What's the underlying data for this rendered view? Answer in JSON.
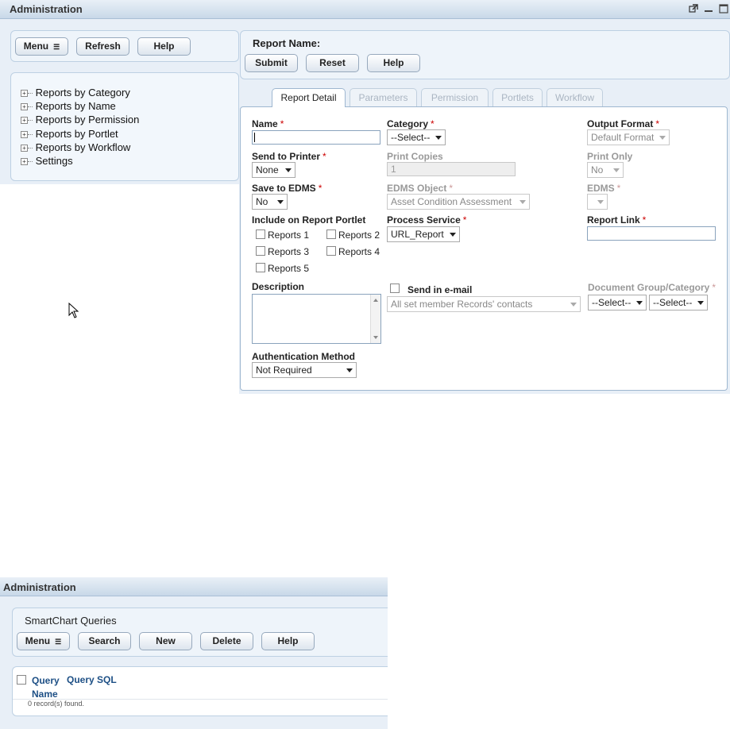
{
  "top": {
    "title": "Administration",
    "left_toolbar": {
      "menu": "Menu",
      "menu_icon": "hamburger-arrow-icon",
      "refresh": "Refresh",
      "help": "Help"
    },
    "tree": [
      {
        "label": "Reports by Category"
      },
      {
        "label": "Reports by Name"
      },
      {
        "label": "Reports by Permission"
      },
      {
        "label": "Reports by Portlet"
      },
      {
        "label": "Reports by Workflow"
      },
      {
        "label": "Settings"
      }
    ],
    "report": {
      "header_label": "Report Name:",
      "buttons": {
        "submit": "Submit",
        "reset": "Reset",
        "help": "Help"
      },
      "tabs": [
        "Report Detail",
        "Parameters",
        "Permission",
        "Portlets",
        "Workflow"
      ],
      "form": {
        "name": {
          "label": "Name",
          "value": ""
        },
        "category": {
          "label": "Category",
          "value": "--Select--"
        },
        "output_format": {
          "label": "Output Format",
          "value": "Default Format"
        },
        "send_to_printer": {
          "label": "Send to Printer",
          "value": "None"
        },
        "print_copies": {
          "label": "Print Copies",
          "value": "1"
        },
        "print_only": {
          "label": "Print Only",
          "value": "No"
        },
        "save_to_edms": {
          "label": "Save to EDMS",
          "value": "No"
        },
        "edms_object": {
          "label": "EDMS Object",
          "value": "Asset Condition Assessment"
        },
        "edms": {
          "label": "EDMS",
          "value": ""
        },
        "include_portlet": {
          "label": "Include on Report Portlet",
          "options": [
            "Reports 1",
            "Reports 2",
            "Reports 3",
            "Reports 4",
            "Reports 5"
          ]
        },
        "process_service": {
          "label": "Process Service",
          "value": "URL_Report"
        },
        "report_link": {
          "label": "Report Link",
          "value": ""
        },
        "description": {
          "label": "Description",
          "value": ""
        },
        "send_email": {
          "label": "Send in e-mail",
          "value": "All set member Records' contacts"
        },
        "doc_group": {
          "label": "Document Group/Category",
          "value1": "--Select--",
          "value2": "--Select--"
        },
        "auth": {
          "label": "Authentication Method",
          "value": "Not Required"
        },
        "required_mark": "*"
      }
    }
  },
  "bottom": {
    "title": "Administration",
    "panel_title": "SmartChart Queries",
    "toolbar": {
      "menu": "Menu",
      "search": "Search",
      "new": "New",
      "delete": "Delete",
      "help": "Help"
    },
    "columns": [
      "Query Name",
      "Query SQL"
    ],
    "records": "0 record(s) found."
  },
  "colors": {
    "accent": "#1d4f85",
    "required": "#cc0000",
    "panel_bg": "#eef4fa"
  }
}
